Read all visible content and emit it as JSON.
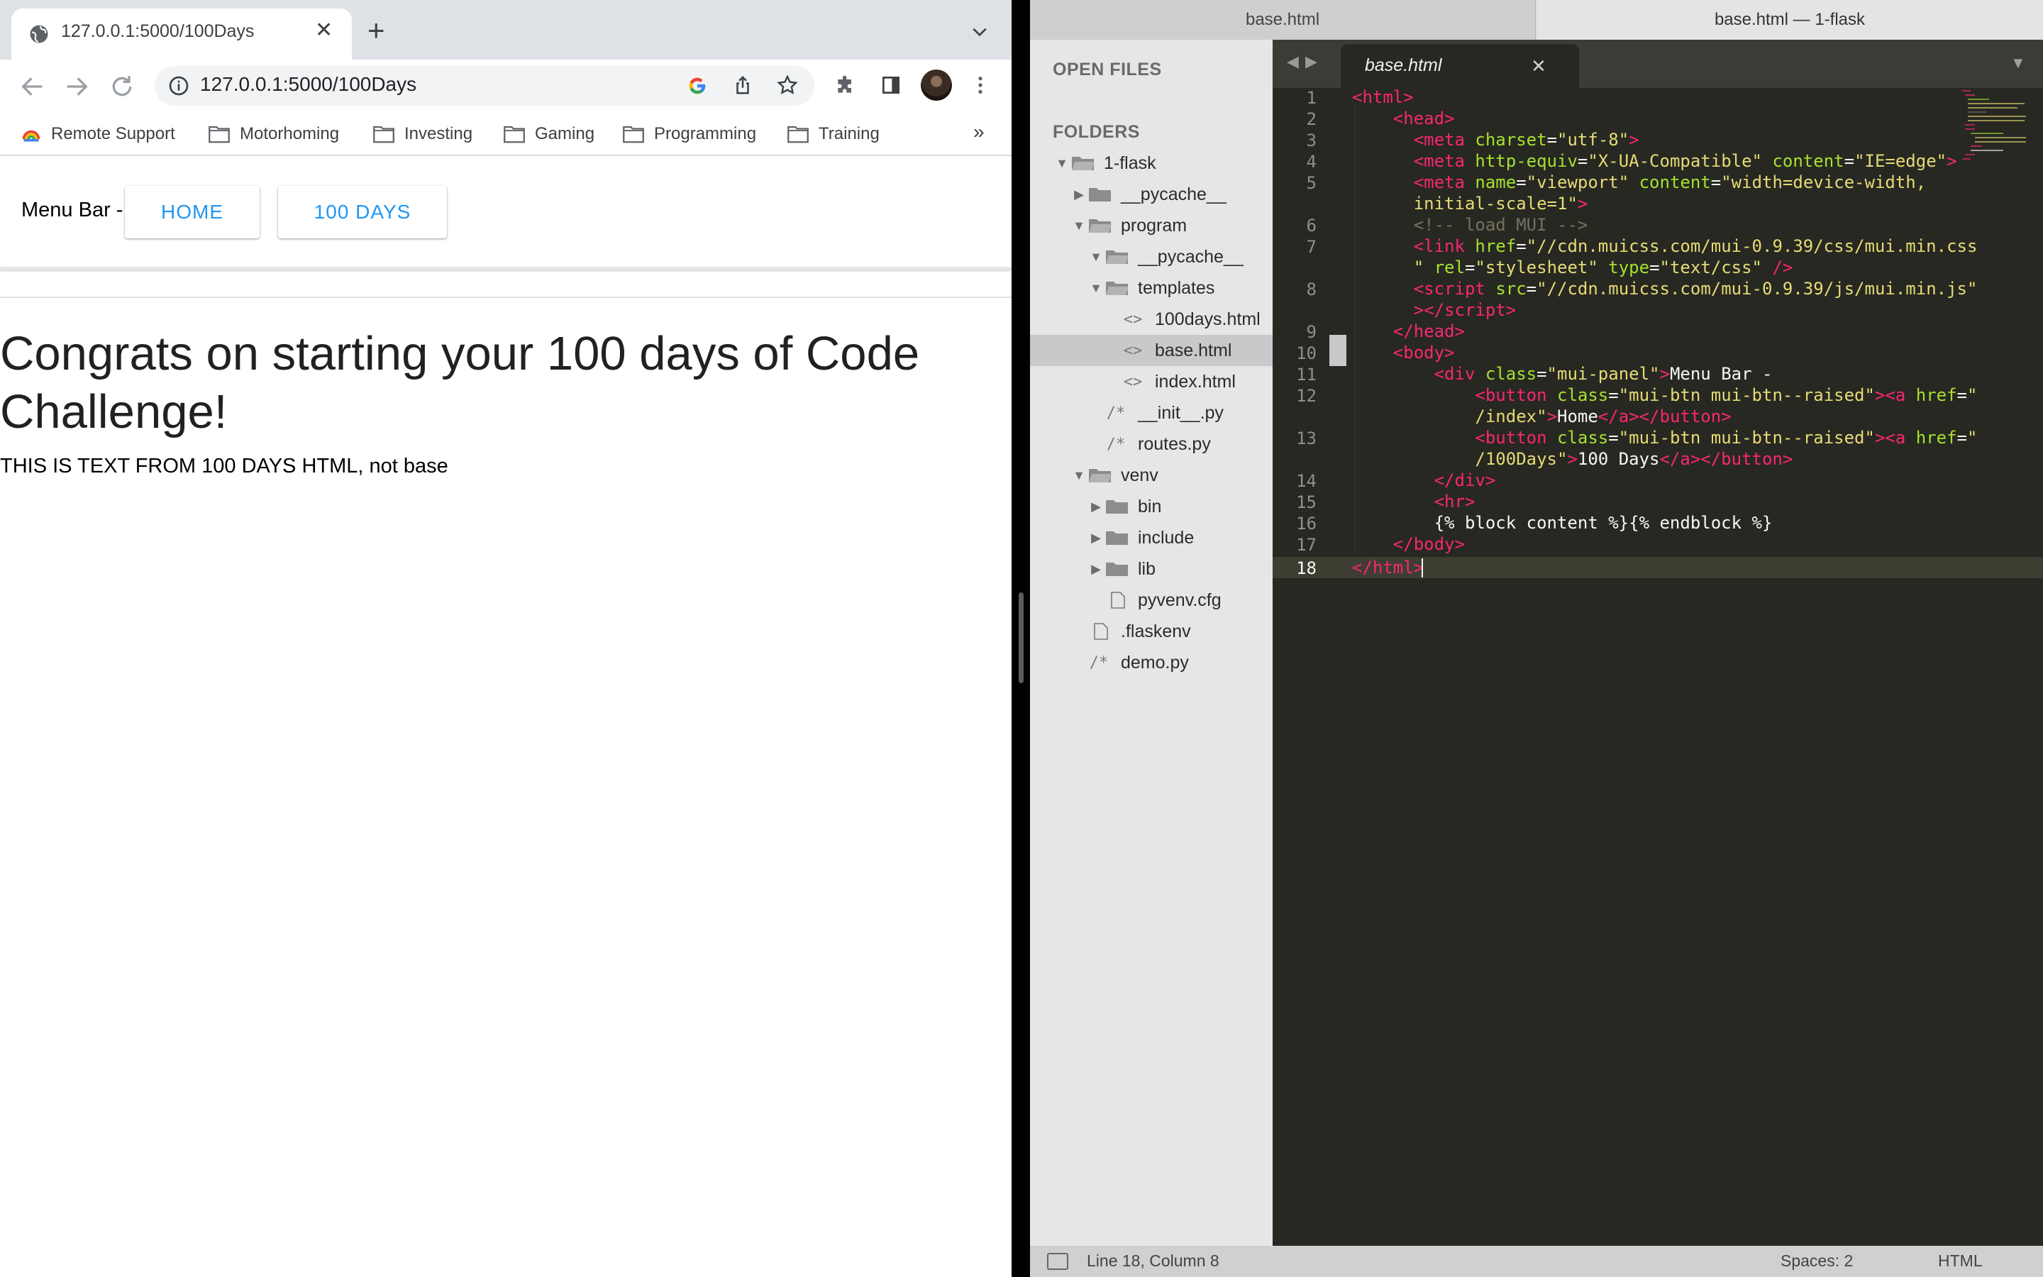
{
  "browser": {
    "tab_title": "127.0.0.1:5000/100Days",
    "url": "127.0.0.1:5000/100Days",
    "bookmarks": [
      "Remote Support",
      "Motorhoming",
      "Investing",
      "Gaming",
      "Programming",
      "Training"
    ],
    "bookmarks_overflow": "»",
    "page": {
      "menu_label": "Menu Bar -",
      "buttons": [
        "HOME",
        "100 DAYS"
      ],
      "heading": "Congrats on starting your 100 days of Code Challenge!",
      "body_text": "THIS IS TEXT FROM 100 DAYS HTML, not base"
    }
  },
  "editor": {
    "window_tabs": [
      "base.html",
      "base.html — 1-flask"
    ],
    "sidebar": {
      "open_files_header": "OPEN FILES",
      "folders_header": "FOLDERS",
      "tree": [
        {
          "label": "1-flask",
          "type": "folder-open"
        },
        {
          "label": "__pycache__",
          "type": "folder-closed"
        },
        {
          "label": "program",
          "type": "folder-open"
        },
        {
          "label": "__pycache__",
          "type": "folder-open"
        },
        {
          "label": "templates",
          "type": "folder-open"
        },
        {
          "label": "100days.html",
          "type": "html"
        },
        {
          "label": "base.html",
          "type": "html",
          "selected": true
        },
        {
          "label": "index.html",
          "type": "html"
        },
        {
          "label": "__init__.py",
          "type": "py"
        },
        {
          "label": "routes.py",
          "type": "py"
        },
        {
          "label": "venv",
          "type": "folder-open"
        },
        {
          "label": "bin",
          "type": "folder-closed"
        },
        {
          "label": "include",
          "type": "folder-closed"
        },
        {
          "label": "lib",
          "type": "folder-closed"
        },
        {
          "label": "pyvenv.cfg",
          "type": "file"
        },
        {
          "label": ".flaskenv",
          "type": "file"
        },
        {
          "label": "demo.py",
          "type": "py"
        }
      ]
    },
    "file_tab": "base.html",
    "line_numbers": [
      "1",
      "2",
      "3",
      "4",
      "5",
      "6",
      "7",
      "8",
      "9",
      "10",
      "11",
      "12",
      "13",
      "14",
      "15",
      "16",
      "17",
      "18"
    ],
    "status": {
      "position": "Line 18, Column 8",
      "spaces": "Spaces: 2",
      "syntax": "HTML"
    },
    "colors": {
      "background": "#272822",
      "tag": "#f92672",
      "attribute": "#a6e22e",
      "string": "#e6db74",
      "comment": "#75715e"
    }
  }
}
